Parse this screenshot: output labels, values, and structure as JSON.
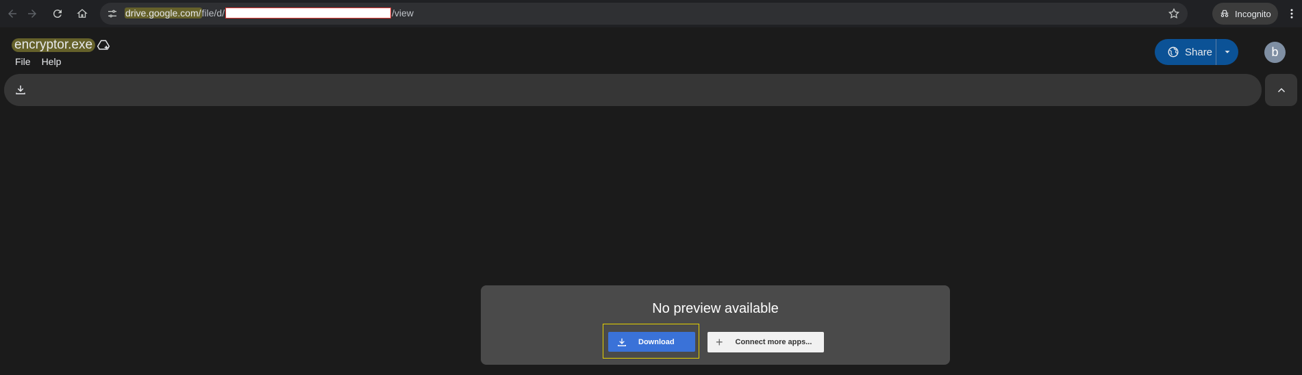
{
  "browser": {
    "url_host": "drive.google.com/",
    "url_path": "file/d/",
    "url_suffix": "/view",
    "incognito_label": "Incognito",
    "icons": [
      "back-icon",
      "forward-icon",
      "reload-icon",
      "home-icon",
      "site-info-icon",
      "bookmark-star-icon",
      "incognito-icon",
      "more-vert-icon"
    ]
  },
  "viewer": {
    "file_name": "encryptor.exe",
    "menu": [
      "File",
      "Help"
    ],
    "share_label": "Share",
    "avatar_letter": "b"
  },
  "preview": {
    "message": "No preview available",
    "download_label": "Download",
    "connect_label": "Connect more apps..."
  },
  "colors": {
    "share_bg": "#0b5296",
    "download_bg": "#3a72d8",
    "highlight": "#65612a",
    "outline": "#e6d200"
  }
}
